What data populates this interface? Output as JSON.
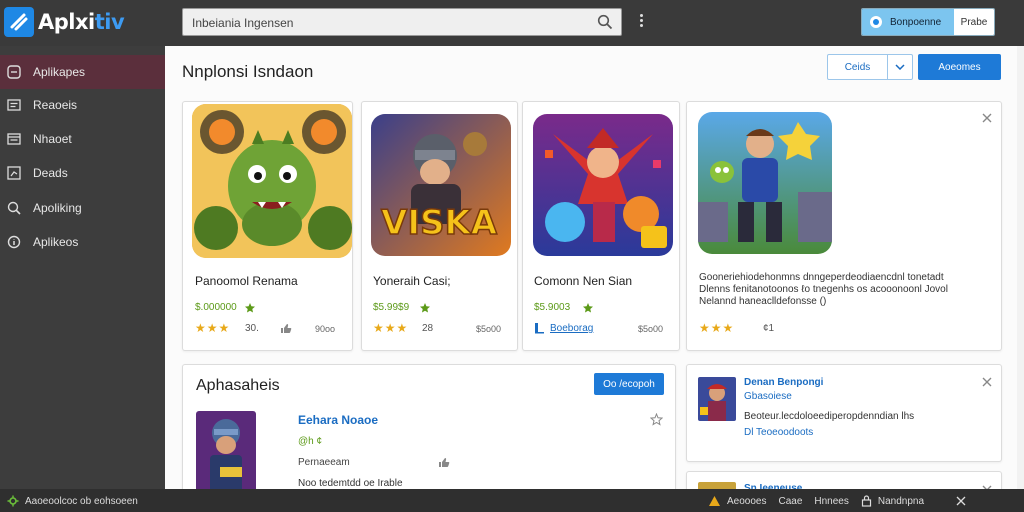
{
  "app": {
    "logo_main": "Aplxi",
    "logo_accent": "tiv"
  },
  "header": {
    "search_text": "Inbeiania Ingensen",
    "status_pill": "Bonpoenne",
    "profile_label": "Prabe"
  },
  "sidebar": {
    "items": [
      {
        "label": "Aplikapes",
        "icon": "home-icon",
        "active": true
      },
      {
        "label": "Reaoeis",
        "icon": "list-icon",
        "active": false
      },
      {
        "label": "Nhaoet",
        "icon": "window-icon",
        "active": false
      },
      {
        "label": "Deads",
        "icon": "chart-icon",
        "active": false
      },
      {
        "label": "Apoliking",
        "icon": "search-icon",
        "active": false
      },
      {
        "label": "Aplikeos",
        "icon": "info-icon",
        "active": false
      }
    ]
  },
  "main": {
    "title": "Nnplonsi Isndaon",
    "outline_button": "Ceids",
    "primary_button": "Aoeomes",
    "cards": [
      {
        "title": "Panoomol Renama",
        "price": "$.000000",
        "rating_count": "30.",
        "size": "90oo",
        "stars": "★★★"
      },
      {
        "title": "Yoneraih Casi;",
        "price": "$5.99$9",
        "rating_count": "28",
        "size": "$5o00",
        "stars": "★★★"
      },
      {
        "title": "Comonn Nen Sian",
        "price": "$5.9003",
        "link": "Boeborag",
        "size": "$5o00"
      },
      {
        "description_1": "Gooneriehiodehonmns dnngeperdeodiaencdnl tonetadt",
        "description_2": "Dlenns fenitanotoonos ℓo tnegenhs os acooonoonl Jovol",
        "description_3": "Nelannd haneaclldefonsse ()",
        "rating_count": "¢1",
        "stars": "★★★"
      }
    ],
    "section": {
      "title": "Aphasaheis",
      "button": "Oo /ecopoh",
      "item_title": "Eehara Noaoe",
      "item_meta": "@h ¢",
      "item_category": "Pernaeeam",
      "item_desc": "Noo tedemtdd oe Irable"
    },
    "side_panel": {
      "title": "Denan Benpongi",
      "subtitle": "Gbasoiese",
      "desc": "Beoteur.lecdoloeediperopdenndian lhs",
      "link": "Dl  Teoeoodoots"
    },
    "bottom_panel": {
      "title": "Sn Ieeneuse"
    }
  },
  "statusbar": {
    "left": "Aaoeoolcoc ob eohsoeen",
    "right_items": [
      "Aeoooes",
      "Caae",
      "Hnnees",
      "Nandnpna"
    ]
  },
  "colors": {
    "accent": "#1e7ad7",
    "sidebar_active": "#5b2f3c",
    "price_green": "#5c9a18",
    "star": "#e8a91a"
  }
}
